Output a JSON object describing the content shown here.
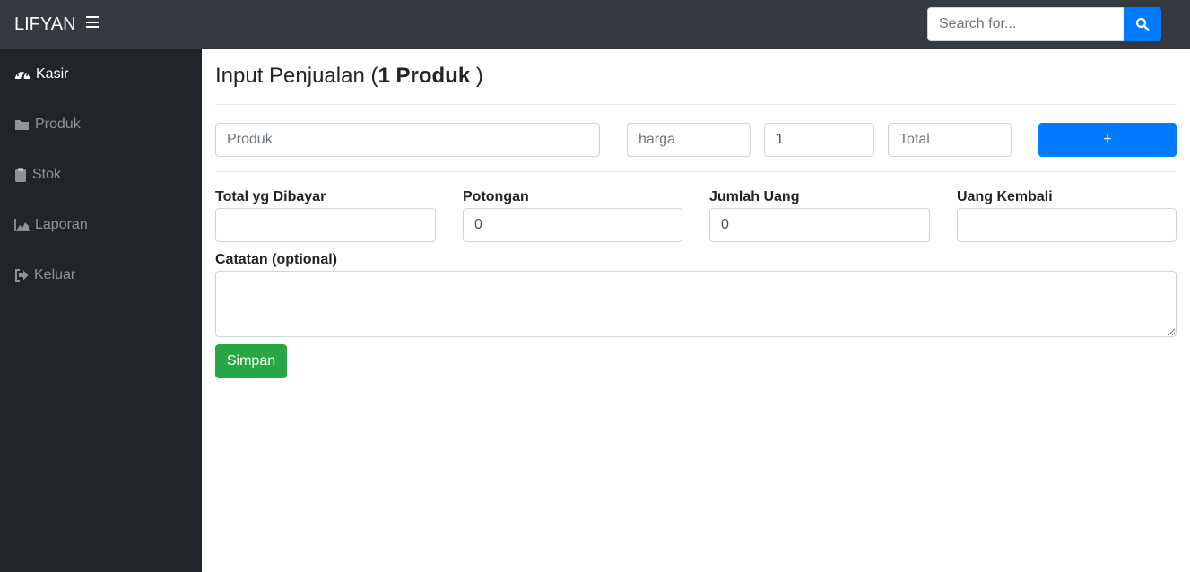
{
  "navbar": {
    "brand": "LIFYAN",
    "search_placeholder": "Search for..."
  },
  "sidebar": {
    "items": [
      {
        "label": "Kasir",
        "icon": "tachometer-icon",
        "active": true
      },
      {
        "label": "Produk",
        "icon": "folder-icon",
        "active": false
      },
      {
        "label": "Stok",
        "icon": "clipboard-icon",
        "active": false
      },
      {
        "label": "Laporan",
        "icon": "area-chart-icon",
        "active": false
      },
      {
        "label": "Keluar",
        "icon": "sign-out-icon",
        "active": false
      }
    ]
  },
  "main": {
    "title_prefix": "Input Penjualan (",
    "title_count": "1 Produk",
    "title_suffix": " )",
    "product_placeholder": "Produk",
    "price_placeholder": "harga",
    "qty_value": "1",
    "total_placeholder": "Total",
    "add_label": "+",
    "fields": {
      "total_label": "Total yg Dibayar",
      "total_value": "",
      "discount_label": "Potongan",
      "discount_value": "0",
      "cash_label": "Jumlah Uang",
      "cash_value": "0",
      "change_label": "Uang Kembali",
      "change_value": ""
    },
    "notes_label": "Catatan (optional)",
    "save_label": "Simpan"
  },
  "colors": {
    "navbar": "#343a40",
    "sidebar": "#212529",
    "primary": "#007bff",
    "success": "#28a745"
  }
}
